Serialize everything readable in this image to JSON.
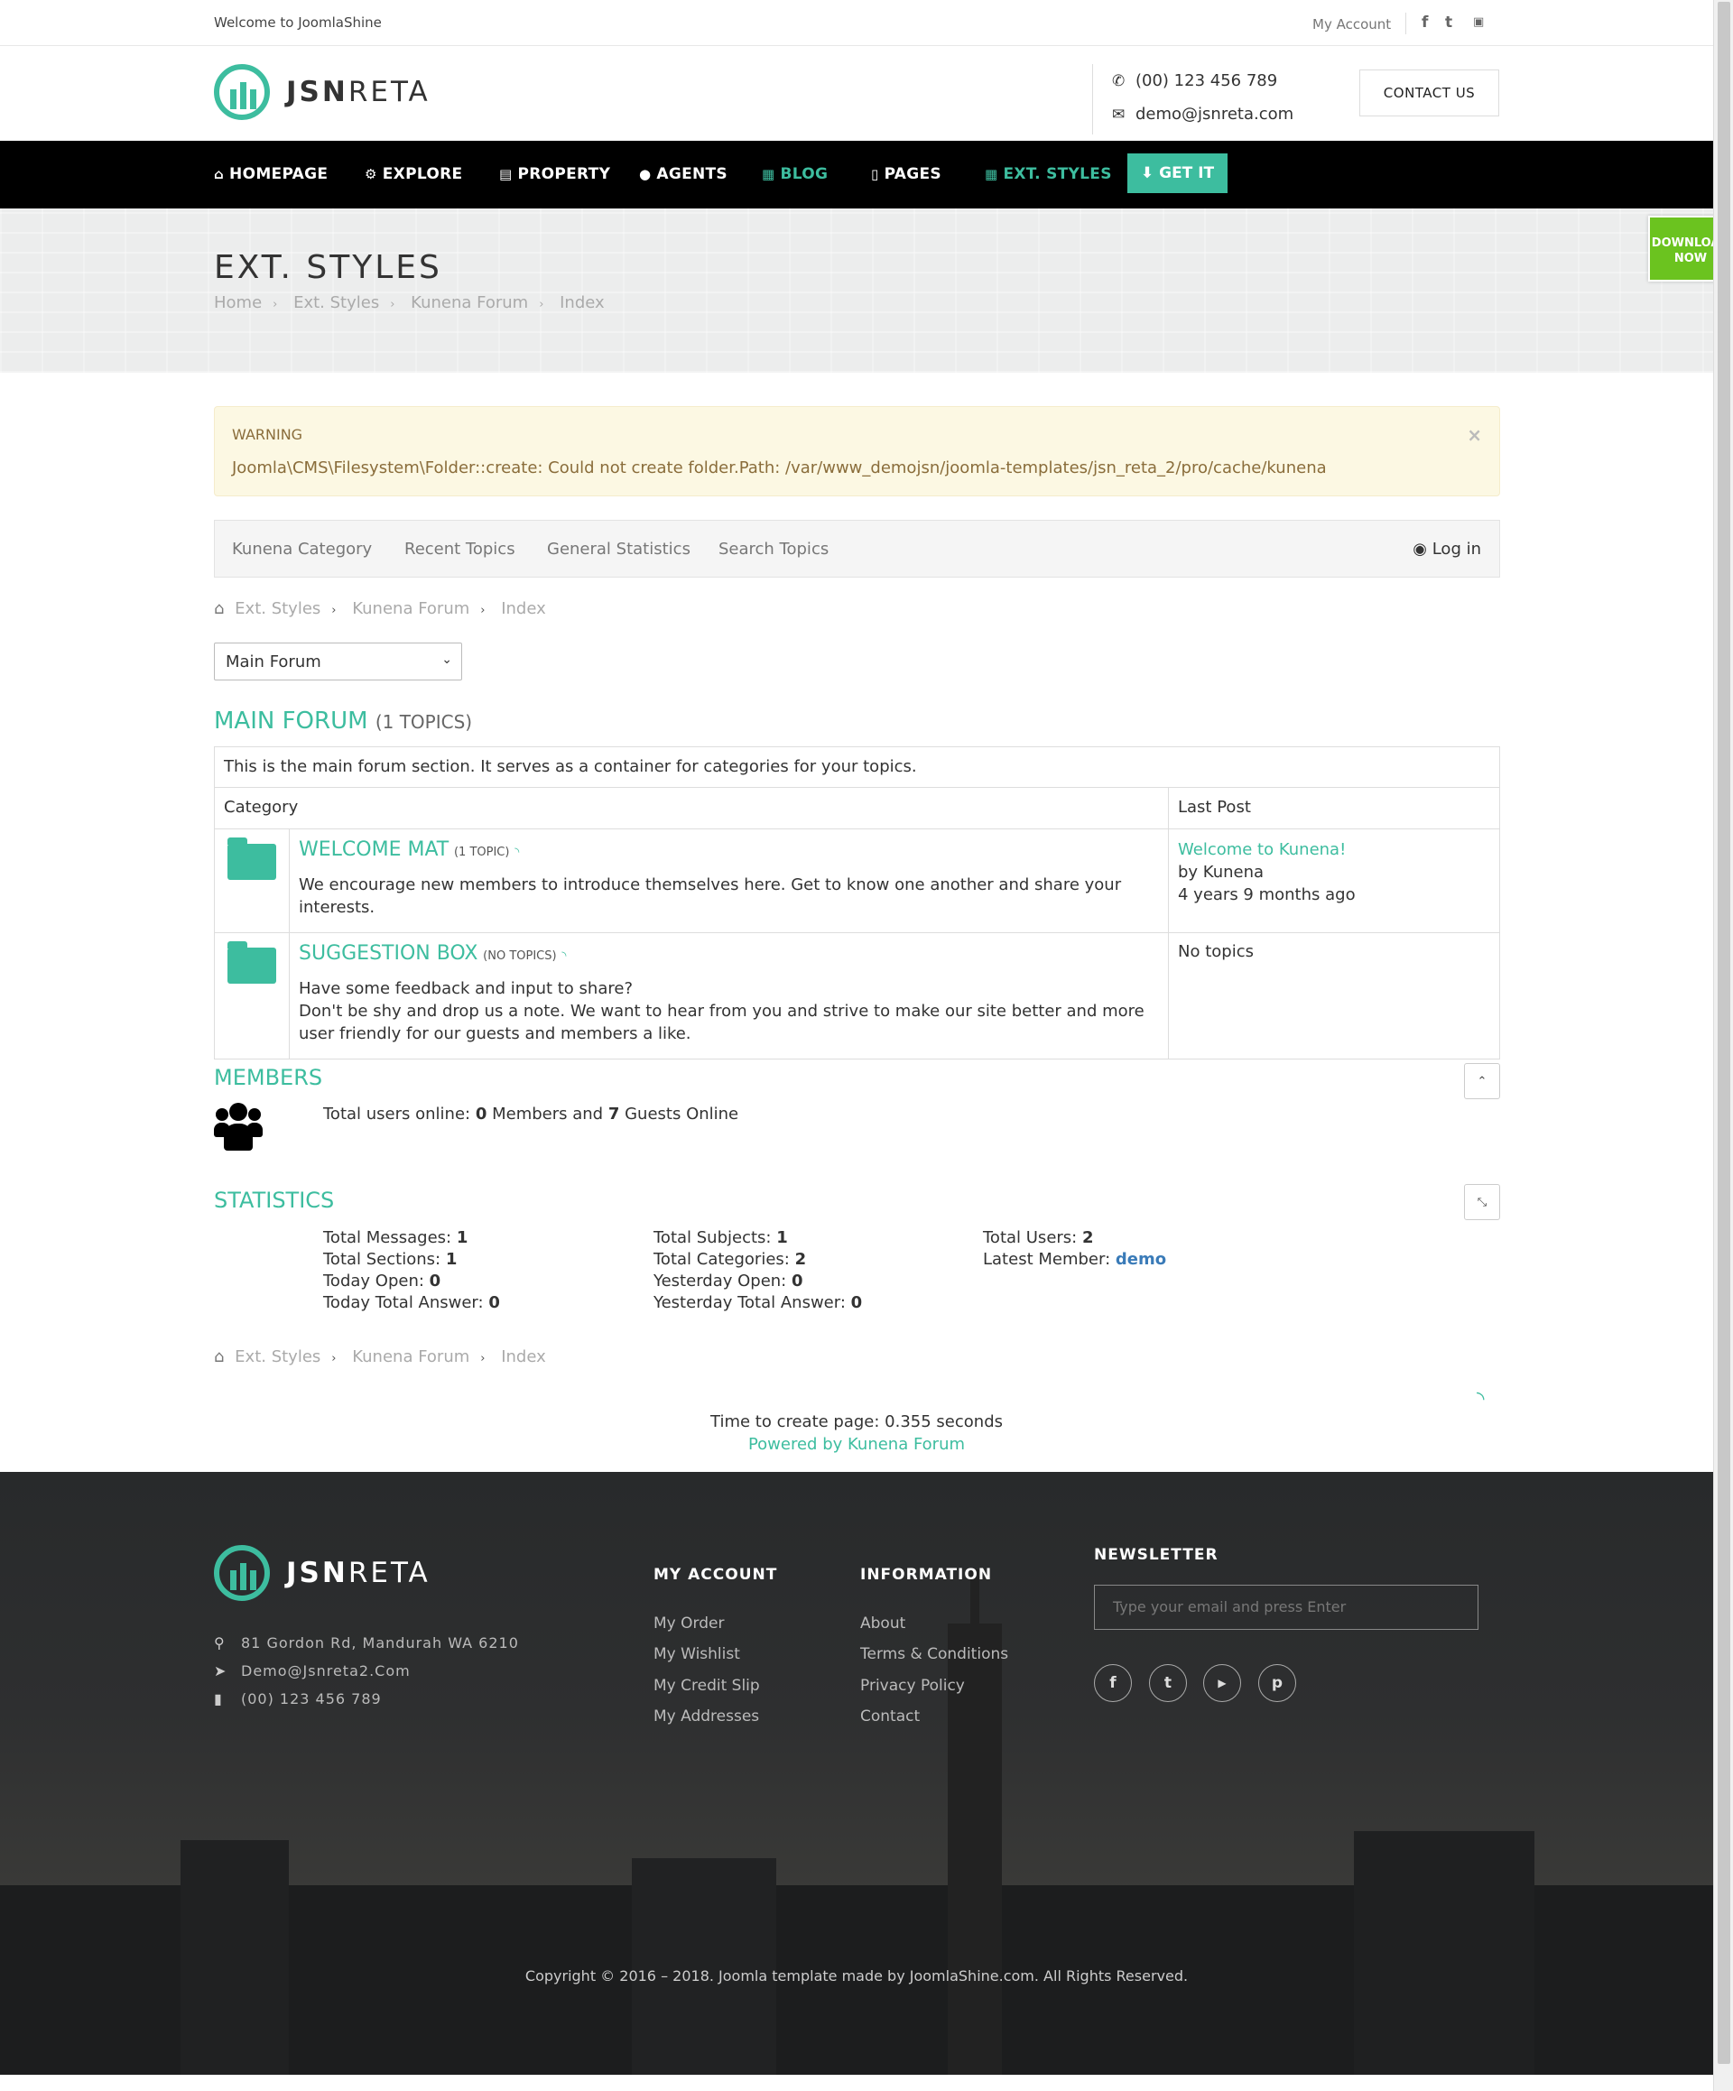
{
  "topbar": {
    "welcome": "Welcome to JoomlaShine",
    "my_account": "My Account",
    "social_icons": [
      "facebook-icon",
      "twitter-icon",
      "youtube-icon"
    ]
  },
  "header": {
    "logo_bold": "JSN",
    "logo_light": "RETA",
    "phone": "(00) 123 456 789",
    "email": "demo@jsnreta.com",
    "contact_button": "CONTACT US"
  },
  "nav": {
    "items": [
      {
        "label": "HOMEPAGE",
        "icon": "home-icon"
      },
      {
        "label": "EXPLORE",
        "icon": "cogs-icon"
      },
      {
        "label": "PROPERTY",
        "icon": "building-icon"
      },
      {
        "label": "AGENTS",
        "icon": "user-icon"
      },
      {
        "label": "BLOG",
        "icon": "newspaper-icon"
      },
      {
        "label": "PAGES",
        "icon": "file-icon"
      },
      {
        "label": "EXT. STYLES",
        "icon": "grid-icon"
      }
    ],
    "get_it": "GET IT",
    "accent": "#3dbd9f"
  },
  "band": {
    "title": "EXT. STYLES",
    "breadcrumb": [
      "Home",
      "Ext. Styles",
      "Kunena Forum",
      "Index"
    ],
    "download_now": [
      "DOWNLOAD",
      "NOW"
    ]
  },
  "warning": {
    "heading": "WARNING",
    "message": "Joomla\\CMS\\Filesystem\\Folder::create: Could not create folder.Path: /var/www_demojsn/joomla-templates/jsn_reta_2/pro/cache/kunena",
    "close": "×"
  },
  "kunena_tabs": {
    "items": [
      "Kunena Category",
      "Recent Topics",
      "General Statistics",
      "Search Topics"
    ],
    "login": "Log in"
  },
  "forum_breadcrumb": [
    "Ext. Styles",
    "Kunena Forum",
    "Index"
  ],
  "forum_select": {
    "value": "Main Forum"
  },
  "main_forum": {
    "title": "MAIN FORUM",
    "count": "(1 TOPICS)",
    "description": "This is the main forum section. It serves as a container for categories for your topics.",
    "col_category": "Category",
    "col_last_post": "Last Post",
    "categories": [
      {
        "name": "WELCOME MAT",
        "count": "(1 TOPIC)",
        "desc": "We encourage new members to introduce themselves here. Get to know one another and share your interests.",
        "last_title": "Welcome to Kunena!",
        "last_by": "by Kunena",
        "last_time": "4 years 9 months ago"
      },
      {
        "name": "SUGGESTION BOX",
        "count": "(NO TOPICS)",
        "desc1": "Have some feedback and input to share?",
        "desc2": "Don't be shy and drop us a note. We want to hear from you and strive to make our site better and more user friendly for our guests and members a like.",
        "no_topics": "No topics"
      }
    ]
  },
  "members": {
    "title": "MEMBERS",
    "prefix": "Total users online:",
    "members": "0",
    "mid": "Members and",
    "guests": "7",
    "suffix": "Guests Online"
  },
  "statistics": {
    "title": "STATISTICS",
    "col1": [
      {
        "label": "Total Messages:",
        "value": "1"
      },
      {
        "label": "Total Sections:",
        "value": "1"
      },
      {
        "label": "Today Open:",
        "value": "0"
      },
      {
        "label": "Today Total Answer:",
        "value": "0"
      }
    ],
    "col2": [
      {
        "label": "Total Subjects:",
        "value": "1"
      },
      {
        "label": "Total Categories:",
        "value": "2"
      },
      {
        "label": "Yesterday Open:",
        "value": "0"
      },
      {
        "label": "Yesterday Total Answer:",
        "value": "0"
      }
    ],
    "col3": [
      {
        "label": "Total Users:",
        "value": "2"
      },
      {
        "label": "Latest Member:",
        "value": "demo"
      }
    ]
  },
  "page_footer": {
    "time": "Time to create page: 0.355 seconds",
    "powered": "Powered by Kunena Forum"
  },
  "footer": {
    "logo_bold": "JSN",
    "logo_light": "RETA",
    "address": "81 Gordon Rd, Mandurah WA 6210",
    "email": "Demo@Jsnreta2.Com",
    "phone": "(00) 123 456 789",
    "my_account_title": "MY ACCOUNT",
    "my_account_links": [
      "My Order",
      "My Wishlist",
      "My Credit Slip",
      "My Addresses"
    ],
    "information_title": "INFORMATION",
    "information_links": [
      "About",
      "Terms & Conditions",
      "Privacy Policy",
      "Contact"
    ],
    "newsletter_title": "NEWSLETTER",
    "newsletter_placeholder": "Type your email and press Enter",
    "social": [
      "facebook-icon",
      "twitter-icon",
      "youtube-icon",
      "pinterest-icon"
    ],
    "copyright": "Copyright © 2016 – 2018. Joomla template made by JoomlaShine.com. All Rights Reserved."
  }
}
